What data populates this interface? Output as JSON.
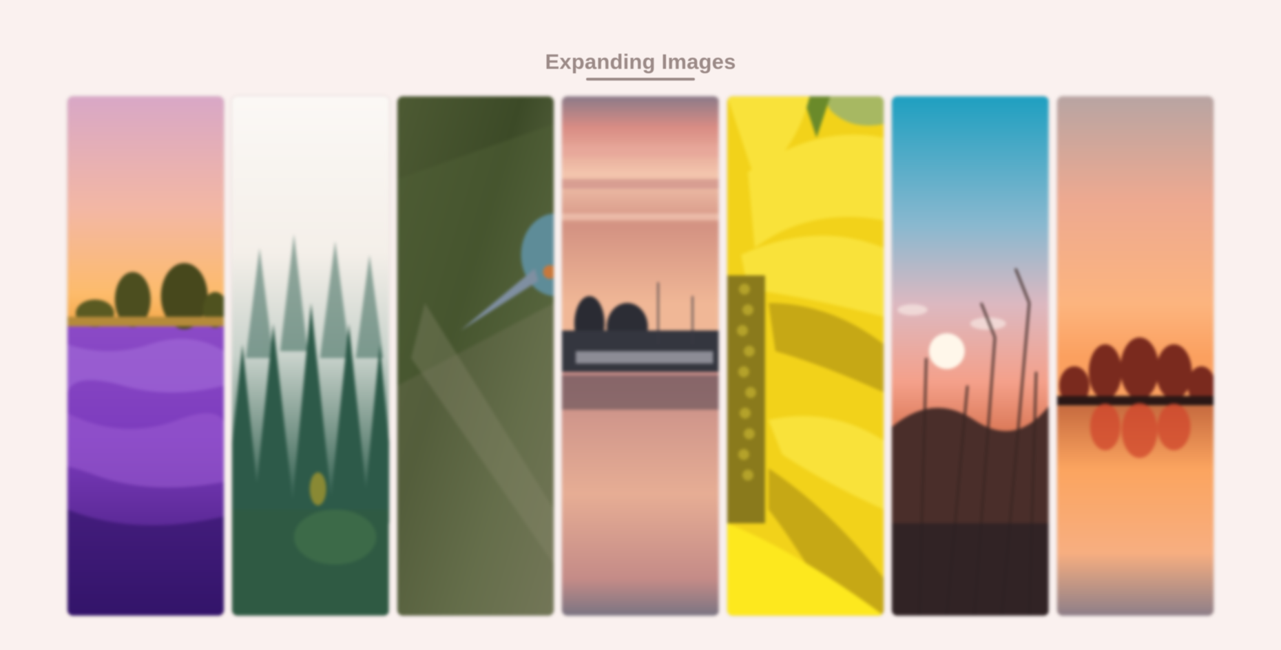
{
  "header": {
    "title": "Expanding Images"
  },
  "gallery": {
    "panels": [
      {
        "name": "lavender-field-sunset-image"
      },
      {
        "name": "misty-forest-image"
      },
      {
        "name": "kingfisher-bird-image"
      },
      {
        "name": "harbor-sunset-image"
      },
      {
        "name": "sunflower-closeup-image"
      },
      {
        "name": "reeds-sunset-image"
      },
      {
        "name": "lake-reflection-sunset-image"
      }
    ]
  },
  "colors": {
    "background": "#faf1ef",
    "title": "#9b8a87"
  }
}
